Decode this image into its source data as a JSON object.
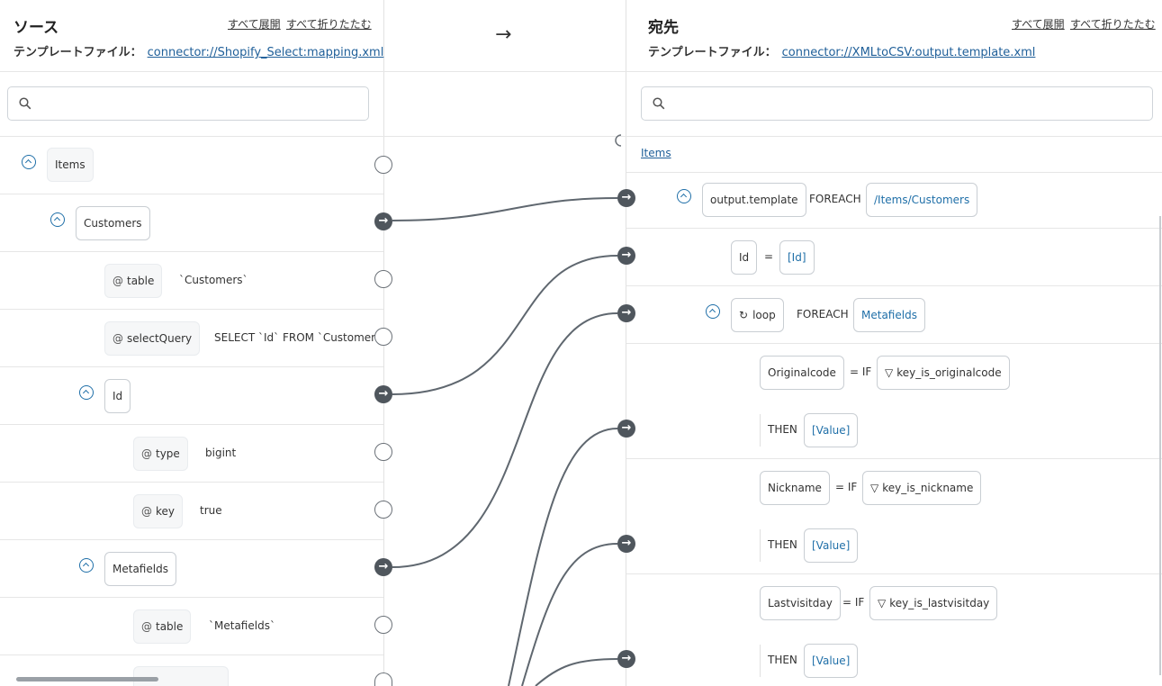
{
  "source": {
    "title": "ソース",
    "expand_all": "すべて展開",
    "collapse_all": "すべて折りたたむ",
    "template_label": "テンプレートファイル：",
    "template_link": "connector://Shopify_Select:mapping.xml",
    "search_placeholder": "",
    "nodes": {
      "items": "Items",
      "customers": "Customers",
      "table_attr": "table",
      "table_value": "`Customers`",
      "select_attr": "selectQuery",
      "select_value": "SELECT `Id` FROM `Customers`",
      "id": "Id",
      "type_attr": "type",
      "type_value": "bigint",
      "key_attr": "key",
      "key_value": "true",
      "metafields": "Metafields",
      "mtable_attr": "table",
      "mtable_value": "`Metafields`"
    }
  },
  "middle": {
    "arrow": "→"
  },
  "dest": {
    "title": "宛先",
    "expand_all": "すべて展開",
    "collapse_all": "すべて折りたたむ",
    "template_label": "テンプレートファイル：",
    "template_link": "connector://XMLtoCSV:output.template.xml",
    "search_placeholder": "",
    "breadcrumb": "Items",
    "nodes": {
      "output_template": "output.template",
      "foreach1": "FOREACH",
      "foreach1_path": "/Items/Customers",
      "id": "Id",
      "eq": "=",
      "id_val": "[Id]",
      "loop": "loop",
      "foreach2": "FOREACH",
      "foreach2_path": "Metafields",
      "originalcode": "Originalcode",
      "eqif": "= IF",
      "cond1": "key_is_originalcode",
      "then": "THEN",
      "value": "[Value]",
      "nickname": "Nickname",
      "cond2": "key_is_nickname",
      "lastvisitday": "Lastvisitday",
      "cond3": "key_is_lastvisitday"
    }
  }
}
